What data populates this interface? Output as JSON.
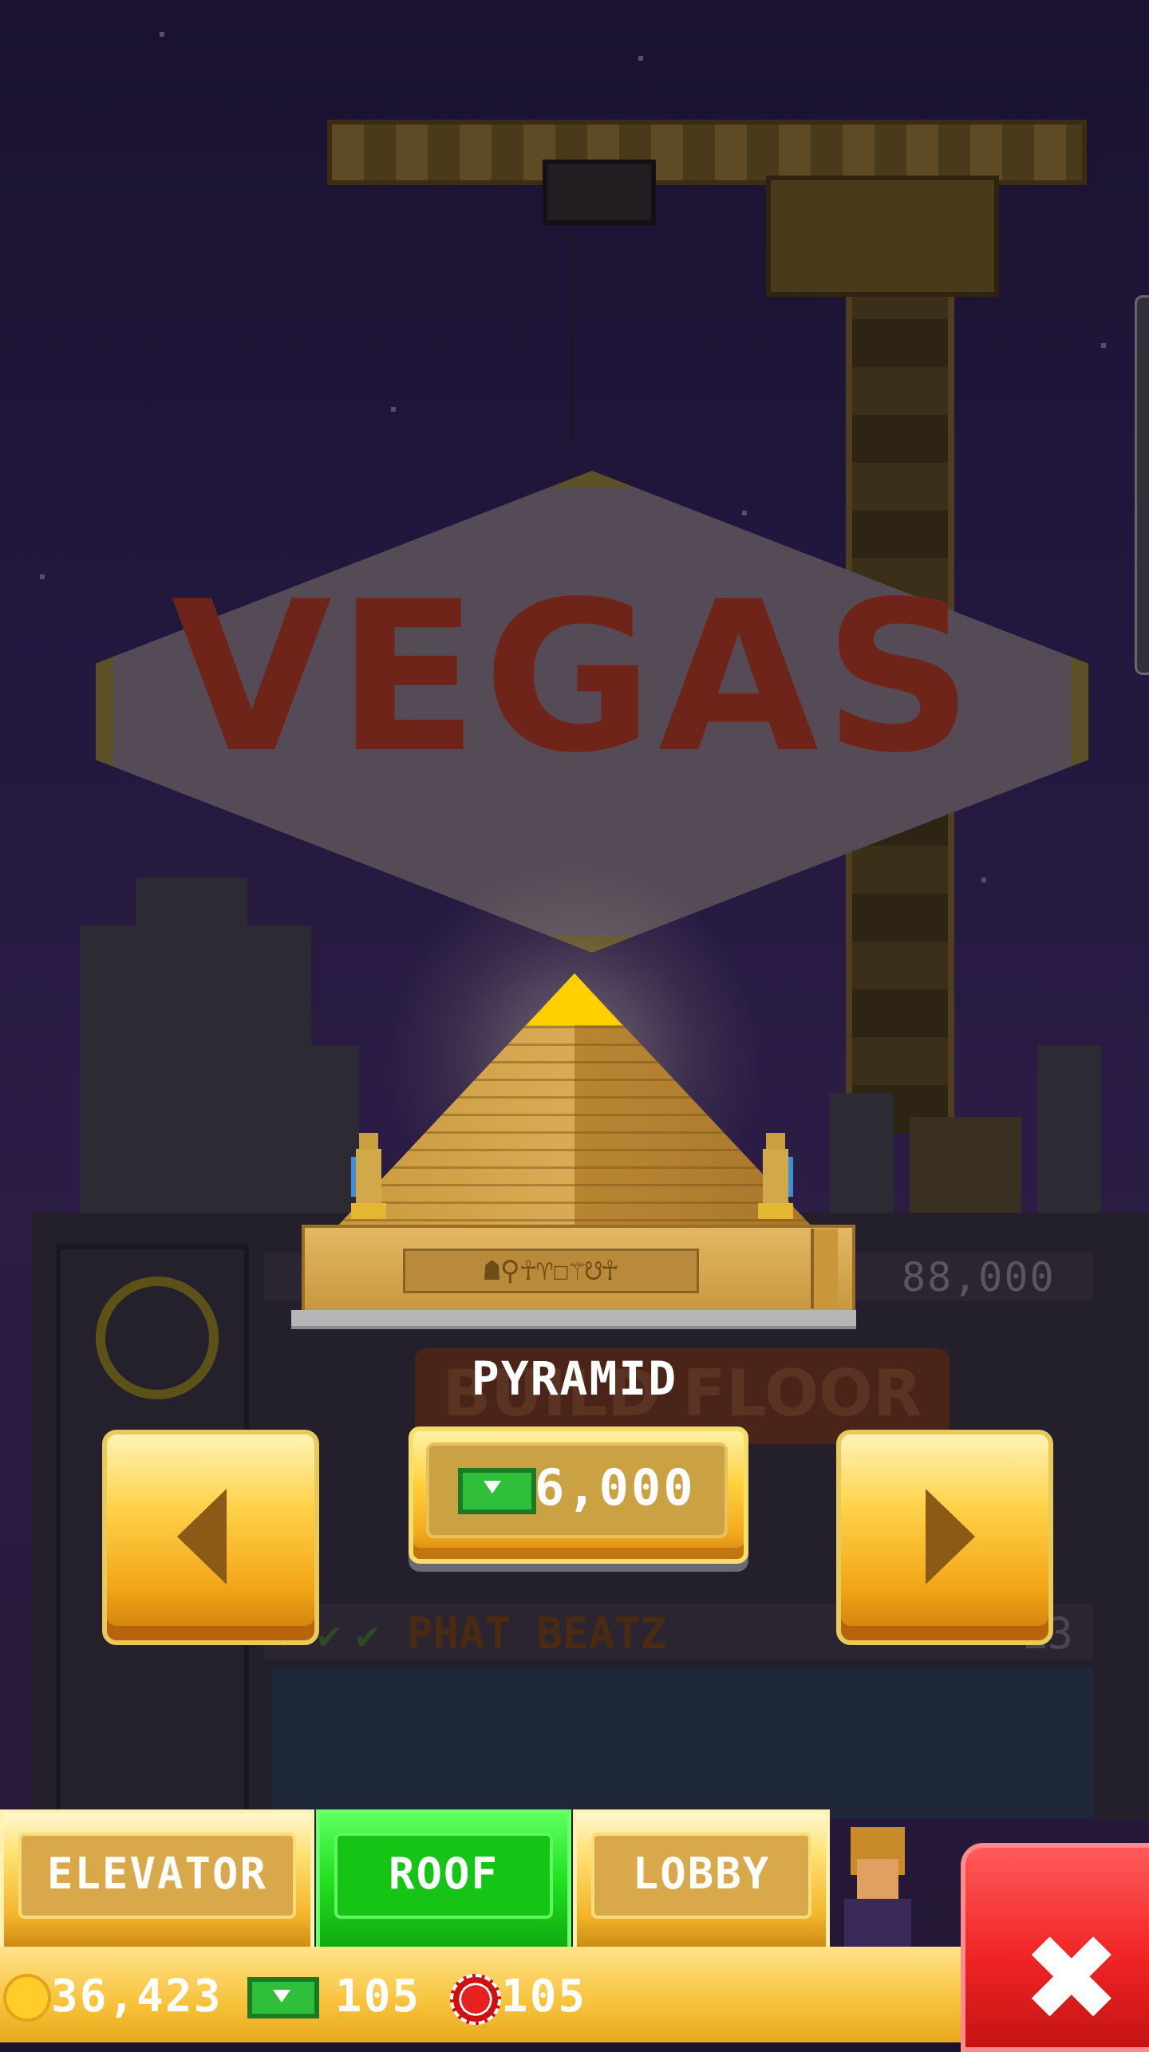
{
  "background": {
    "sign_text": "VEGAS",
    "floor_price": "88,000",
    "build_floor_label": "BUILD FLOOR",
    "floor_name": "PHAT BEATZ",
    "floor_number": "L3"
  },
  "selector": {
    "item_name": "PYRAMID",
    "price": "6,000",
    "currency_icon": "bux-icon",
    "hieroglyphs": "☗⚲☥♈☐⚚☋☥"
  },
  "tabs": [
    {
      "label": "ELEVATOR",
      "active": false
    },
    {
      "label": "ROOF",
      "active": true
    },
    {
      "label": "LOBBY",
      "active": false
    }
  ],
  "resources": {
    "coins": "36,423",
    "bux": "105",
    "chips": "105"
  },
  "close_icon": "close-icon",
  "colors": {
    "gold": "#f7c23a",
    "active_tab": "#20e020",
    "close": "#f02424"
  }
}
